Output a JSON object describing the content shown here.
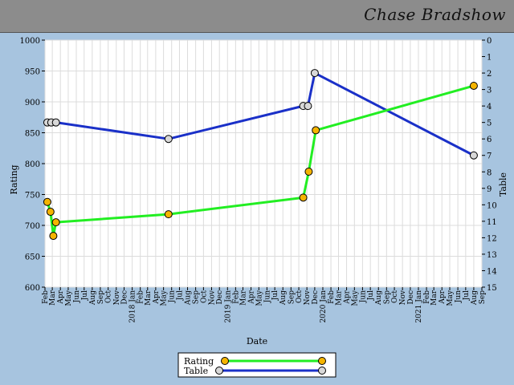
{
  "header": {
    "player_name": "Chase Bradshow"
  },
  "chart_data": {
    "type": "line",
    "xlabel": "Date",
    "ylabel_left": "Rating",
    "ylabel_right": "Table",
    "ylim_left": [
      600,
      1000
    ],
    "ylim_right": [
      0,
      15
    ],
    "right_axis_inverted": true,
    "left_ticks": [
      600,
      650,
      700,
      750,
      800,
      850,
      900,
      950,
      1000
    ],
    "right_ticks": [
      0,
      1,
      2,
      3,
      4,
      5,
      6,
      7,
      8,
      9,
      10,
      11,
      12,
      13,
      14,
      15
    ],
    "x_ticks": [
      {
        "label": "Feb",
        "year": 2017,
        "month": 2
      },
      {
        "label": "Mar",
        "year": 2017,
        "month": 3
      },
      {
        "label": "Apr",
        "year": 2017,
        "month": 4
      },
      {
        "label": "May",
        "year": 2017,
        "month": 5
      },
      {
        "label": "Jun",
        "year": 2017,
        "month": 6
      },
      {
        "label": "Jul",
        "year": 2017,
        "month": 7
      },
      {
        "label": "Aug",
        "year": 2017,
        "month": 8
      },
      {
        "label": "Sep",
        "year": 2017,
        "month": 9
      },
      {
        "label": "Oct",
        "year": 2017,
        "month": 10
      },
      {
        "label": "Nov",
        "year": 2017,
        "month": 11
      },
      {
        "label": "Dec",
        "year": 2017,
        "month": 12
      },
      {
        "label": "2018 Jan",
        "year": 2018,
        "month": 1
      },
      {
        "label": "Feb",
        "year": 2018,
        "month": 2
      },
      {
        "label": "Mar",
        "year": 2018,
        "month": 3
      },
      {
        "label": "Apr",
        "year": 2018,
        "month": 4
      },
      {
        "label": "May",
        "year": 2018,
        "month": 5
      },
      {
        "label": "Jun",
        "year": 2018,
        "month": 6
      },
      {
        "label": "Jul",
        "year": 2018,
        "month": 7
      },
      {
        "label": "Aug",
        "year": 2018,
        "month": 8
      },
      {
        "label": "Sep",
        "year": 2018,
        "month": 9
      },
      {
        "label": "Oct",
        "year": 2018,
        "month": 10
      },
      {
        "label": "Nov",
        "year": 2018,
        "month": 11
      },
      {
        "label": "Dec",
        "year": 2018,
        "month": 12
      },
      {
        "label": "2019 Jan",
        "year": 2019,
        "month": 1
      },
      {
        "label": "Feb",
        "year": 2019,
        "month": 2
      },
      {
        "label": "Mar",
        "year": 2019,
        "month": 3
      },
      {
        "label": "Apr",
        "year": 2019,
        "month": 4
      },
      {
        "label": "May",
        "year": 2019,
        "month": 5
      },
      {
        "label": "Jun",
        "year": 2019,
        "month": 6
      },
      {
        "label": "Jul",
        "year": 2019,
        "month": 7
      },
      {
        "label": "Aug",
        "year": 2019,
        "month": 8
      },
      {
        "label": "Sep",
        "year": 2019,
        "month": 9
      },
      {
        "label": "Oct",
        "year": 2019,
        "month": 10
      },
      {
        "label": "Nov",
        "year": 2019,
        "month": 11
      },
      {
        "label": "Dec",
        "year": 2019,
        "month": 12
      },
      {
        "label": "2020 Jan",
        "year": 2020,
        "month": 1
      },
      {
        "label": "Feb",
        "year": 2020,
        "month": 2
      },
      {
        "label": "Mar",
        "year": 2020,
        "month": 3
      },
      {
        "label": "Apr",
        "year": 2020,
        "month": 4
      },
      {
        "label": "May",
        "year": 2020,
        "month": 5
      },
      {
        "label": "Jun",
        "year": 2020,
        "month": 6
      },
      {
        "label": "Jul",
        "year": 2020,
        "month": 7
      },
      {
        "label": "Aug",
        "year": 2020,
        "month": 8
      },
      {
        "label": "Sep",
        "year": 2020,
        "month": 9
      },
      {
        "label": "Oct",
        "year": 2020,
        "month": 10
      },
      {
        "label": "Nov",
        "year": 2020,
        "month": 11
      },
      {
        "label": "Dec",
        "year": 2020,
        "month": 12
      },
      {
        "label": "2021 Jan",
        "year": 2021,
        "month": 1
      },
      {
        "label": "Feb",
        "year": 2021,
        "month": 2
      },
      {
        "label": "Mar",
        "year": 2021,
        "month": 3
      },
      {
        "label": "Apr",
        "year": 2021,
        "month": 4
      },
      {
        "label": "May",
        "year": 2021,
        "month": 5
      },
      {
        "label": "Jun",
        "year": 2021,
        "month": 6
      },
      {
        "label": "Jul",
        "year": 2021,
        "month": 7
      },
      {
        "label": "Aug",
        "year": 2021,
        "month": 8
      },
      {
        "label": "Sep",
        "year": 2021,
        "month": 9
      }
    ],
    "series": [
      {
        "name": "Rating",
        "axis": "left",
        "line_color": "#22ee22",
        "marker_color": "#f5b400",
        "points": [
          {
            "x": "2017-02-10",
            "y": 738
          },
          {
            "x": "2017-02-22",
            "y": 722
          },
          {
            "x": "2017-03-05",
            "y": 683
          },
          {
            "x": "2017-03-15",
            "y": 705
          },
          {
            "x": "2018-05-20",
            "y": 718
          },
          {
            "x": "2019-10-18",
            "y": 745
          },
          {
            "x": "2019-11-08",
            "y": 787
          },
          {
            "x": "2019-12-05",
            "y": 854
          },
          {
            "x": "2021-08-01",
            "y": 926
          }
        ]
      },
      {
        "name": "Table",
        "axis": "right",
        "line_color": "#1a30c8",
        "marker_color": "#d8d8d8",
        "points": [
          {
            "x": "2017-02-10",
            "y": 5
          },
          {
            "x": "2017-02-25",
            "y": 5
          },
          {
            "x": "2017-03-15",
            "y": 5
          },
          {
            "x": "2018-05-20",
            "y": 6
          },
          {
            "x": "2019-10-18",
            "y": 4
          },
          {
            "x": "2019-11-05",
            "y": 4
          },
          {
            "x": "2019-12-01",
            "y": 2
          },
          {
            "x": "2021-08-01",
            "y": 7
          }
        ]
      }
    ],
    "legend_position": "bottom-center",
    "grid": true
  }
}
